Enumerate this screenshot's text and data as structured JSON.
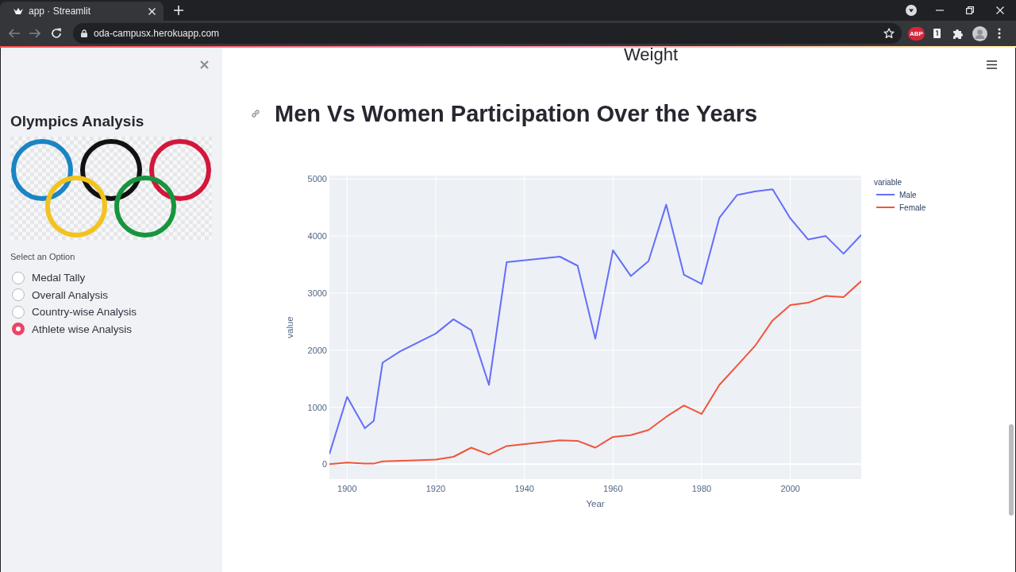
{
  "browser": {
    "tabs": [
      {
        "title": "app · Streamlit",
        "selected": true
      }
    ],
    "address": "oda-campusx.herokuapp.com",
    "extension_badge": "ABP"
  },
  "sidebar": {
    "title": "Olympics Analysis",
    "option_label": "Select an Option",
    "options": [
      {
        "label": "Medal Tally",
        "selected": false
      },
      {
        "label": "Overall Analysis",
        "selected": false
      },
      {
        "label": "Country-wise Analysis",
        "selected": false
      },
      {
        "label": "Athlete wise Analysis",
        "selected": true
      }
    ]
  },
  "main": {
    "previous_chart_title": "Weight",
    "heading": "Men Vs Women Participation Over the Years",
    "chart_data": [
      {
        "type": "line",
        "xlabel": "Year",
        "ylabel": "value",
        "legend_title": "variable",
        "legend": "right",
        "grid": true,
        "x": [
          1896,
          1900,
          1904,
          1906,
          1908,
          1912,
          1920,
          1924,
          1928,
          1932,
          1936,
          1948,
          1952,
          1956,
          1960,
          1964,
          1968,
          1972,
          1976,
          1980,
          1984,
          1988,
          1992,
          1996,
          2000,
          2004,
          2008,
          2012,
          2016
        ],
        "series": [
          {
            "name": "Male",
            "color": "#636efa",
            "values": [
              180,
              1180,
              630,
              760,
              1780,
              1980,
              2290,
              2540,
              2350,
              1390,
              3540,
              3640,
              3480,
              2200,
              3750,
              3300,
              3560,
              4550,
              3320,
              3160,
              4320,
              4720,
              4780,
              4820,
              4310,
              3940,
              4000,
              3690,
              4020
            ]
          },
          {
            "name": "Female",
            "color": "#ef553b",
            "values": [
              0,
              30,
              10,
              10,
              50,
              60,
              80,
              130,
              290,
              170,
              320,
              420,
              410,
              290,
              480,
              510,
              600,
              830,
              1030,
              880,
              1390,
              1730,
              2070,
              2520,
              2790,
              2830,
              2950,
              2930,
              3210
            ]
          }
        ],
        "xlim": [
          1896,
          2016
        ],
        "ylim": [
          -260,
          5060
        ],
        "xticks": [
          1900,
          1920,
          1940,
          1960,
          1980,
          2000
        ],
        "yticks": [
          0,
          1000,
          2000,
          3000,
          4000,
          5000
        ]
      }
    ]
  }
}
